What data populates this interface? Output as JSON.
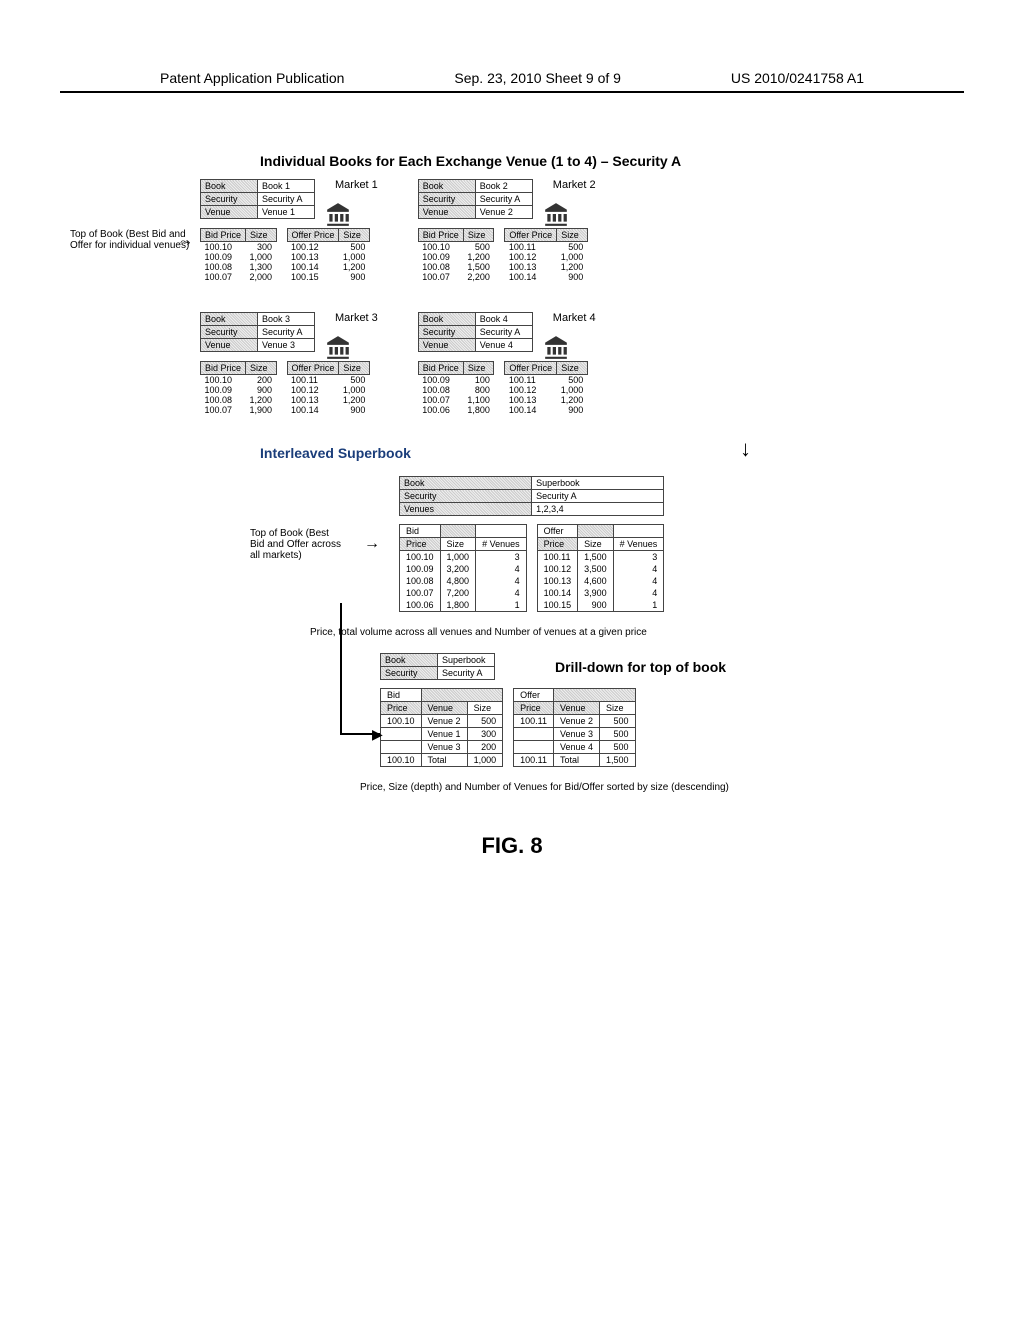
{
  "header": {
    "left": "Patent Application Publication",
    "center": "Sep. 23, 2010  Sheet 9 of 9",
    "right": "US 2010/0241758 A1"
  },
  "title1": "Individual Books for Each Exchange Venue (1 to 4) –  Security A",
  "side_label_top": "Top of Book (Best Bid and Offer for individual venues)",
  "markets": [
    {
      "label": "Market  1",
      "meta": [
        [
          "Book",
          "Book 1"
        ],
        [
          "Security",
          "Security A"
        ],
        [
          "Venue",
          "Venue 1"
        ]
      ],
      "bid_headers": [
        "Bid Price",
        "Size"
      ],
      "bid_rows": [
        [
          "100.10",
          "300"
        ],
        [
          "100.09",
          "1,000"
        ],
        [
          "100.08",
          "1,300"
        ],
        [
          "100.07",
          "2,000"
        ]
      ],
      "offer_headers": [
        "Offer Price",
        "Size"
      ],
      "offer_rows": [
        [
          "100.12",
          "500"
        ],
        [
          "100.13",
          "1,000"
        ],
        [
          "100.14",
          "1,200"
        ],
        [
          "100.15",
          "900"
        ]
      ]
    },
    {
      "label": "Market  2",
      "meta": [
        [
          "Book",
          "Book 2"
        ],
        [
          "Security",
          "Security A"
        ],
        [
          "Venue",
          "Venue 2"
        ]
      ],
      "bid_headers": [
        "Bid Price",
        "Size"
      ],
      "bid_rows": [
        [
          "100.10",
          "500"
        ],
        [
          "100.09",
          "1,200"
        ],
        [
          "100.08",
          "1,500"
        ],
        [
          "100.07",
          "2,200"
        ]
      ],
      "offer_headers": [
        "Offer Price",
        "Size"
      ],
      "offer_rows": [
        [
          "100.11",
          "500"
        ],
        [
          "100.12",
          "1,000"
        ],
        [
          "100.13",
          "1,200"
        ],
        [
          "100.14",
          "900"
        ]
      ]
    },
    {
      "label": "Market  3",
      "meta": [
        [
          "Book",
          "Book 3"
        ],
        [
          "Security",
          "Security A"
        ],
        [
          "Venue",
          "Venue 3"
        ]
      ],
      "bid_headers": [
        "Bid Price",
        "Size"
      ],
      "bid_rows": [
        [
          "100.10",
          "200"
        ],
        [
          "100.09",
          "900"
        ],
        [
          "100.08",
          "1,200"
        ],
        [
          "100.07",
          "1,900"
        ]
      ],
      "offer_headers": [
        "Offer Price",
        "Size"
      ],
      "offer_rows": [
        [
          "100.11",
          "500"
        ],
        [
          "100.12",
          "1,000"
        ],
        [
          "100.13",
          "1,200"
        ],
        [
          "100.14",
          "900"
        ]
      ]
    },
    {
      "label": "Market  4",
      "meta": [
        [
          "Book",
          "Book 4"
        ],
        [
          "Security",
          "Security A"
        ],
        [
          "Venue",
          "Venue 4"
        ]
      ],
      "bid_headers": [
        "Bid Price",
        "Size"
      ],
      "bid_rows": [
        [
          "100.09",
          "100"
        ],
        [
          "100.08",
          "800"
        ],
        [
          "100.07",
          "1,100"
        ],
        [
          "100.06",
          "1,800"
        ]
      ],
      "offer_headers": [
        "Offer Price",
        "Size"
      ],
      "offer_rows": [
        [
          "100.11",
          "500"
        ],
        [
          "100.12",
          "1,000"
        ],
        [
          "100.13",
          "1,200"
        ],
        [
          "100.14",
          "900"
        ]
      ]
    }
  ],
  "title2": "Interleaved Superbook",
  "superbook": {
    "meta": [
      [
        "Book",
        "Superbook"
      ],
      [
        "Security",
        "Security A"
      ],
      [
        "Venues",
        "1,2,3,4"
      ]
    ],
    "left_label": "Top of Book (Best Bid and Offer across all markets)",
    "bid_headers": [
      "Bid",
      "",
      ""
    ],
    "bid_sub": [
      "Price",
      "Size",
      "# Venues"
    ],
    "bid_rows": [
      [
        "100.10",
        "1,000",
        "3"
      ],
      [
        "100.09",
        "3,200",
        "4"
      ],
      [
        "100.08",
        "4,800",
        "4"
      ],
      [
        "100.07",
        "7,200",
        "4"
      ],
      [
        "100.06",
        "1,800",
        "1"
      ]
    ],
    "offer_headers": [
      "Offer",
      "",
      ""
    ],
    "offer_sub": [
      "Price",
      "Size",
      "# Venues"
    ],
    "offer_rows": [
      [
        "100.11",
        "1,500",
        "3"
      ],
      [
        "100.12",
        "3,500",
        "4"
      ],
      [
        "100.13",
        "4,600",
        "4"
      ],
      [
        "100.14",
        "3,900",
        "4"
      ],
      [
        "100.15",
        "900",
        "1"
      ]
    ]
  },
  "caption1": "Price, total volume across all venues and Number of venues at a given price",
  "drill": {
    "meta": [
      [
        "Book",
        "Superbook"
      ],
      [
        "Security",
        "Security A"
      ]
    ],
    "title": "Drill-down for top of book",
    "bid_headers": [
      "Bid",
      "",
      ""
    ],
    "bid_sub": [
      "Price",
      "Venue",
      "Size"
    ],
    "bid_rows": [
      [
        "100.10",
        "Venue 2",
        "500"
      ],
      [
        "",
        "Venue 1",
        "300"
      ],
      [
        "",
        "Venue 3",
        "200"
      ]
    ],
    "bid_total": [
      "100.10",
      "Total",
      "1,000"
    ],
    "offer_headers": [
      "Offer",
      "",
      ""
    ],
    "offer_sub": [
      "Price",
      "Venue",
      "Size"
    ],
    "offer_rows": [
      [
        "100.11",
        "Venue 2",
        "500"
      ],
      [
        "",
        "Venue 3",
        "500"
      ],
      [
        "",
        "Venue 4",
        "500"
      ]
    ],
    "offer_total": [
      "100.11",
      "Total",
      "1,500"
    ]
  },
  "caption2": "Price, Size (depth)  and Number of Venues for Bid/Offer sorted by size (descending)",
  "fig": "FIG. 8"
}
